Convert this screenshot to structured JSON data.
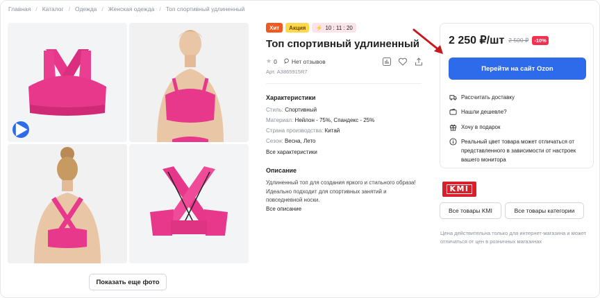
{
  "breadcrumbs": [
    "Главная",
    "Каталог",
    "Одежда",
    "Женская одежда",
    "Топ спортивный удлиненный"
  ],
  "gallery": {
    "show_more_label": "Показать еще фото",
    "accent_color": "#e8388c"
  },
  "badges": {
    "hit": "Хит",
    "promo": "Акция",
    "timer": "10 : 11 : 20"
  },
  "product": {
    "title": "Топ спортивный удлиненный",
    "rating": "0",
    "reviews": "Нет отзывов",
    "article": "Арт. A3865915R7"
  },
  "specs": {
    "heading": "Характеристики",
    "rows": [
      {
        "label": "Стиль:",
        "value": "Спортивный"
      },
      {
        "label": "Материал:",
        "value": "Нейлон - 75%, Спандекс - 25%"
      },
      {
        "label": "Страна производства:",
        "value": "Китай"
      },
      {
        "label": "Сезон:",
        "value": "Весна, Лето"
      }
    ],
    "all_link": "Все характеристики"
  },
  "description": {
    "heading": "Описание",
    "text": "Удлиненный топ для создания яркого и стильного образа! Идеально подходит для спортивных занятий и повседневной носки.",
    "all_link": "Все описание"
  },
  "buy": {
    "price": "2 250 ₽/шт",
    "old_price": "2 500 ₽",
    "discount": "-10%",
    "button": "Перейти на сайт Ozon",
    "options": [
      {
        "icon": "truck-icon",
        "text": "Рассчитать доставку"
      },
      {
        "icon": "wallet-icon",
        "text": "Нашли дешевле?"
      },
      {
        "icon": "gift-icon",
        "text": "Хочу в подарок"
      },
      {
        "icon": "info-icon",
        "text": "Реальный цвет товара может отличаться от представленного в зависимости от настроек вашего монитора"
      }
    ],
    "accent_color": "#2d6bea"
  },
  "seller": {
    "logo_text": "KMI",
    "all_brand": "Все товары KMI",
    "all_category": "Все товары категории",
    "note": "Цена действительна только для интернет-магазина и может отличаться от цен в розничных магазинах"
  }
}
